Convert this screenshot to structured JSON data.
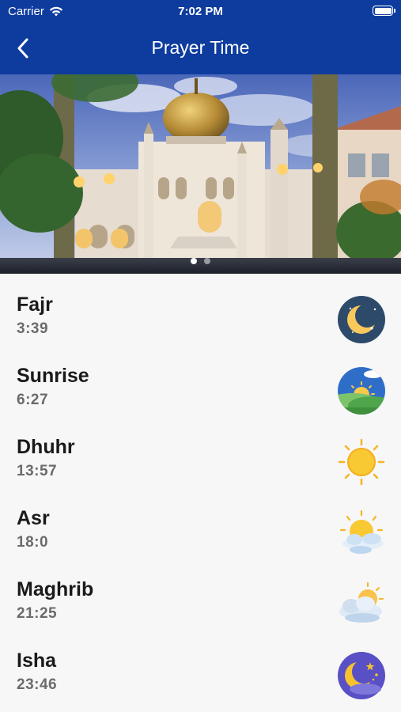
{
  "status_bar": {
    "carrier": "Carrier",
    "time": "7:02 PM"
  },
  "nav": {
    "title": "Prayer Time",
    "back_icon": "chevron-left-icon"
  },
  "hero": {
    "image": "mosque photo",
    "page_count": 2,
    "current_page": 1
  },
  "prayers": [
    {
      "name": "Fajr",
      "time": "3:39",
      "icon": "crescent-moon-icon"
    },
    {
      "name": "Sunrise",
      "time": "6:27",
      "icon": "sunrise-landscape-icon"
    },
    {
      "name": "Dhuhr",
      "time": "13:57",
      "icon": "sun-icon"
    },
    {
      "name": "Asr",
      "time": "18:0",
      "icon": "sun-behind-cloud-icon"
    },
    {
      "name": "Maghrib",
      "time": "21:25",
      "icon": "sunset-cloud-icon"
    },
    {
      "name": "Isha",
      "time": "23:46",
      "icon": "night-moon-stars-icon"
    }
  ],
  "colors": {
    "primary": "#0d3c9e",
    "background": "#f7f7f7",
    "time_text": "#6b6b6b"
  }
}
